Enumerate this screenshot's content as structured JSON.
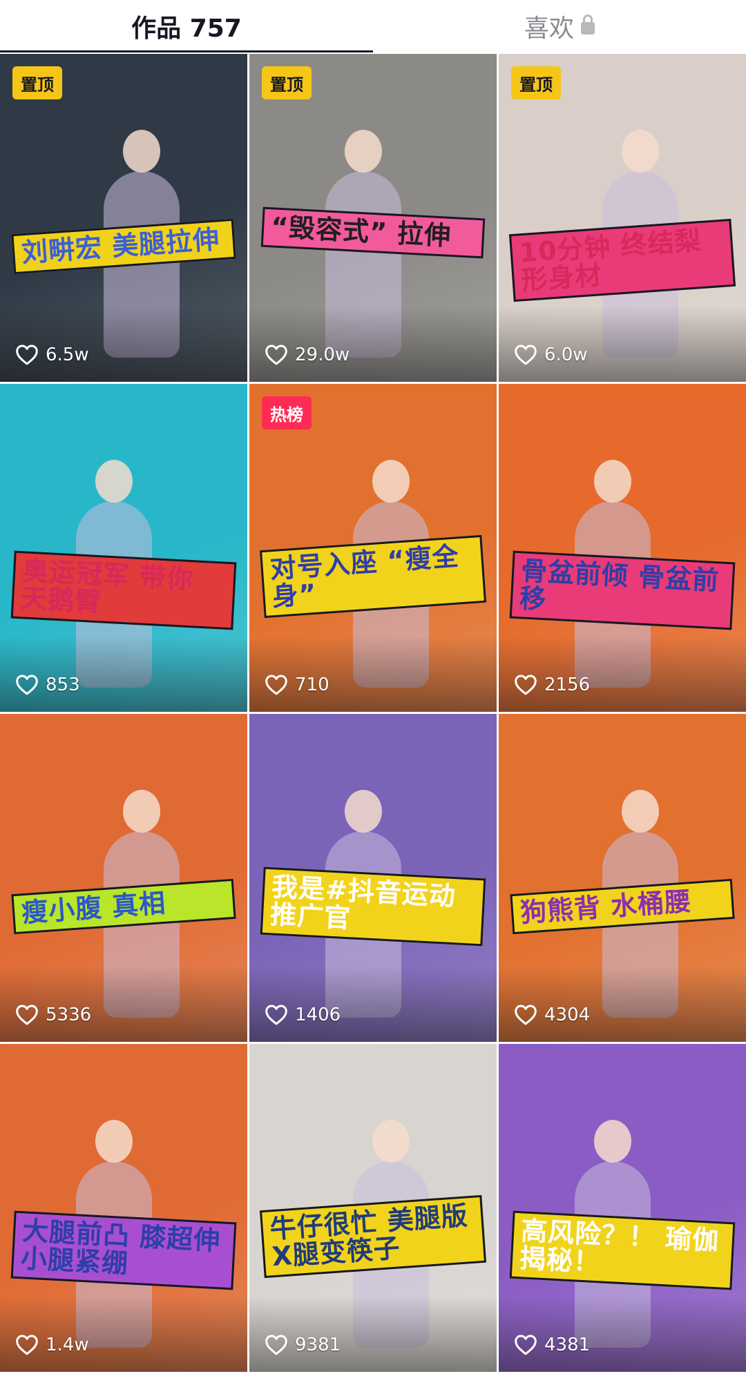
{
  "tabs": {
    "works_label": "作品 757",
    "likes_label": "喜欢",
    "likes_icon": "lock-icon"
  },
  "colors": {
    "pin_badge": "#f5c518",
    "hot_badge": "#fe2c55",
    "active_tab": "#161823",
    "inactive_tab": "#8a8b91"
  },
  "videos": [
    {
      "badge": "置顶",
      "badge_type": "pin",
      "likes": "6.5w",
      "headline": "刘畊宏 美腿拉伸",
      "bg": "#2f3a46",
      "accent": "#f0d21b",
      "text_color": "#3a5fd8"
    },
    {
      "badge": "置顶",
      "badge_type": "pin",
      "likes": "29.0w",
      "headline": "“毁容式” 拉伸",
      "bg": "#8c8a86",
      "accent": "#f25a9b",
      "text_color": "#1f1f1f"
    },
    {
      "badge": "置顶",
      "badge_type": "pin",
      "likes": "6.0w",
      "headline": "10分钟 终结梨形身材",
      "bg": "#d9cfc8",
      "accent": "#e93b77",
      "text_color": "#d8285c"
    },
    {
      "badge": "",
      "badge_type": "",
      "likes": "853",
      "headline": "奥运冠军 带你 天鹅臂",
      "bg": "#27b7c9",
      "accent": "#e13b3b",
      "text_color": "#d8285c"
    },
    {
      "badge": "热榜",
      "badge_type": "hot",
      "likes": "710",
      "headline": "对号入座 “瘦全身”",
      "bg": "#e2702e",
      "accent": "#f2d31b",
      "text_color": "#2e3ea8"
    },
    {
      "badge": "",
      "badge_type": "",
      "likes": "2156",
      "headline": "骨盆前倾 骨盆前移",
      "bg": "#e56a2c",
      "accent": "#e93b77",
      "text_color": "#2e3ea8"
    },
    {
      "badge": "",
      "badge_type": "",
      "likes": "5336",
      "headline": "瘦小腹 真相",
      "bg": "#e06a33",
      "accent": "#b9e52a",
      "text_color": "#2b58c9"
    },
    {
      "badge": "",
      "badge_type": "",
      "likes": "1406",
      "headline": "我是#抖音运动推广官",
      "bg": "#7b63b8",
      "accent": "#f2d31b",
      "text_color": "#ffffff"
    },
    {
      "badge": "",
      "badge_type": "",
      "likes": "4304",
      "headline": "狗熊背 水桶腰",
      "bg": "#e2702e",
      "accent": "#f2d31b",
      "text_color": "#8a2fb0"
    },
    {
      "badge": "",
      "badge_type": "",
      "likes": "1.4w",
      "headline": "大腿前凸 膝超伸 小腿紧绷",
      "bg": "#e06a33",
      "accent": "#a84fd1",
      "text_color": "#2e3ea8"
    },
    {
      "badge": "",
      "badge_type": "",
      "likes": "9381",
      "headline": "牛仔很忙 美腿版 X腿变筷子",
      "bg": "#d8d4cf",
      "accent": "#f2d31b",
      "text_color": "#1f3c7a"
    },
    {
      "badge": "",
      "badge_type": "",
      "likes": "4381",
      "headline": "高风险？！ 瑜伽 揭秘！",
      "bg": "#8a5cc4",
      "accent": "#f2d31b",
      "text_color": "#ffffff"
    }
  ]
}
